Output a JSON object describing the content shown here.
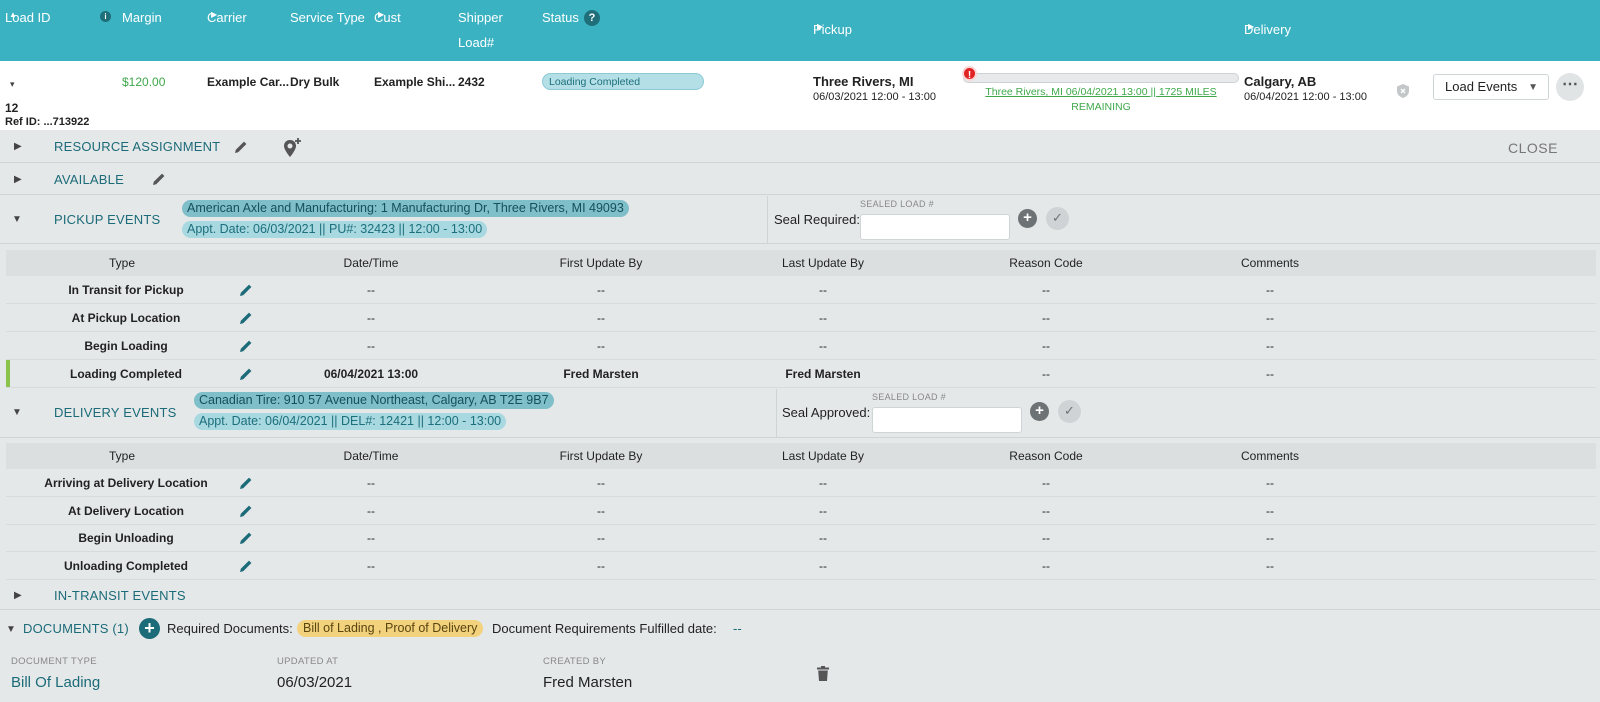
{
  "header": {
    "load_id": "Load ID",
    "margin": "Margin",
    "carrier": "Carrier",
    "service_type": "Service Type",
    "cust": "Cust",
    "shipper": "Shipper",
    "load_num": "Load#",
    "status": "Status",
    "pickup": "Pickup",
    "delivery": "Delivery"
  },
  "load": {
    "id": "12",
    "ref_id": "Ref ID: ...713922",
    "margin": "$120.00",
    "carrier": "Example Car...",
    "service_type": "Dry Bulk",
    "customer": "Example Shi...",
    "shipper_load": "2432",
    "status": "Loading Completed",
    "pickup_city": "Three Rivers, MI",
    "pickup_window": "06/03/2021 12:00 - 13:00",
    "progress_fraction": 0.0,
    "progress_link": "Three Rivers, MI 06/04/2021 13:00 || 1725 MILES",
    "progress_link_2": "REMAINING",
    "delivery_city": "Calgary, AB",
    "delivery_window": "06/04/2021 12:00 - 13:00",
    "load_events_select": "Load Events",
    "alert_icon_text": "!"
  },
  "sections": {
    "resource": "RESOURCE ASSIGNMENT",
    "available": "AVAILABLE",
    "close": "CLOSE",
    "pickup": "PICKUP EVENTS",
    "delivery": "DELIVERY EVENTS",
    "in_transit": "IN-TRANSIT EVENTS",
    "documents": "DOCUMENTS (1)"
  },
  "pickup": {
    "address": "American Axle and Manufacturing: 1 Manufacturing Dr, Three Rivers, MI 49093",
    "appt": "Appt. Date: 06/03/2021 || PU#: 32423 || 12:00 - 13:00",
    "seal_label": "Seal Required:",
    "sealed_caption": "SEALED LOAD #",
    "seal_value": ""
  },
  "delivery": {
    "address": "Canadian Tire: 910 57 Avenue Northeast, Calgary, AB T2E 9B7",
    "appt": "Appt. Date: 06/04/2021 || DEL#: 12421 || 12:00 - 13:00",
    "seal_label": "Seal Approved:",
    "sealed_caption": "SEALED LOAD #",
    "seal_value": ""
  },
  "table_headers": [
    "Type",
    "Date/Time",
    "First Update By",
    "Last Update By",
    "Reason Code",
    "Comments"
  ],
  "pickup_events": [
    {
      "type": "In Transit for Pickup",
      "datetime": "--",
      "first": "--",
      "last": "--",
      "reason": "--",
      "comments": "--"
    },
    {
      "type": "At Pickup Location",
      "datetime": "--",
      "first": "--",
      "last": "--",
      "reason": "--",
      "comments": "--"
    },
    {
      "type": "Begin Loading",
      "datetime": "--",
      "first": "--",
      "last": "--",
      "reason": "--",
      "comments": "--"
    },
    {
      "type": "Loading Completed",
      "datetime": "06/04/2021 13:00",
      "first": "Fred Marsten",
      "last": "Fred Marsten",
      "reason": "--",
      "comments": "--"
    }
  ],
  "delivery_events": [
    {
      "type": "Arriving at Delivery Location",
      "datetime": "--",
      "first": "--",
      "last": "--",
      "reason": "--",
      "comments": "--"
    },
    {
      "type": "At Delivery Location",
      "datetime": "--",
      "first": "--",
      "last": "--",
      "reason": "--",
      "comments": "--"
    },
    {
      "type": "Begin Unloading",
      "datetime": "--",
      "first": "--",
      "last": "--",
      "reason": "--",
      "comments": "--"
    },
    {
      "type": "Unloading Completed",
      "datetime": "--",
      "first": "--",
      "last": "--",
      "reason": "--",
      "comments": "--"
    }
  ],
  "documents": {
    "required_label": "Required Documents:",
    "required_value": "Bill of Lading , Proof of Delivery",
    "fulfilled_label": "Document Requirements Fulfilled date:",
    "fulfilled_value": "--",
    "col_type": "DOCUMENT TYPE",
    "col_updated": "UPDATED AT",
    "col_created": "CREATED BY",
    "rows": [
      {
        "type": "Bill Of Lading",
        "updated": "06/03/2021",
        "created_by": "Fred Marsten"
      }
    ]
  },
  "colors": {
    "header_bg": "#3bb2c2",
    "accent_teal": "#1b6b78",
    "margin_green": "#3fa84a",
    "alert_red": "#e02424",
    "completed_bar": "#8bc34a",
    "required_docs_pill": "#f2d27d"
  },
  "icons": [
    "sort-asc-icon",
    "info-icon",
    "help-icon",
    "chevron-right-icon",
    "chevron-down-icon",
    "alert-icon",
    "shield-icon",
    "pencil-icon",
    "add-location-icon",
    "plus-circle-icon",
    "check-icon",
    "trash-icon",
    "more-icon"
  ]
}
